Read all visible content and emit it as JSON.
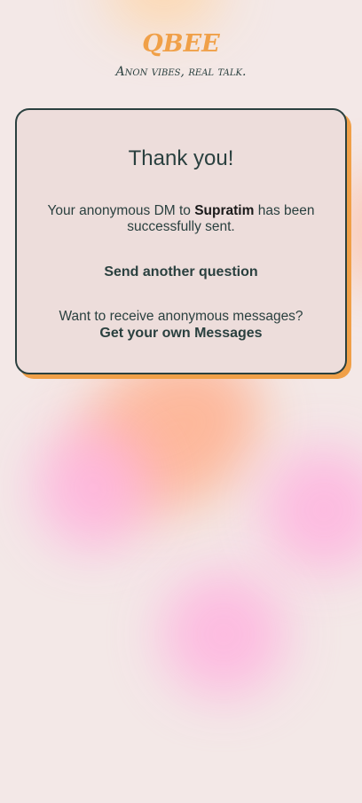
{
  "brand": {
    "logo_text": "QBEE",
    "tagline": "Anon vibes, real talk."
  },
  "card": {
    "title": "Thank you!",
    "message_prefix": "Your anonymous DM to",
    "recipient": "Supratim",
    "message_suffix": "has been successfully sent.",
    "send_another_label": "Send another question",
    "receive_prompt": "Want to receive anonymous messages?",
    "own_messages_label": "Get your own Messages"
  },
  "colors": {
    "accent": "#f0a048",
    "text": "#2a403f",
    "card_background": "#eddddb",
    "page_background": "#f3e8e7"
  }
}
